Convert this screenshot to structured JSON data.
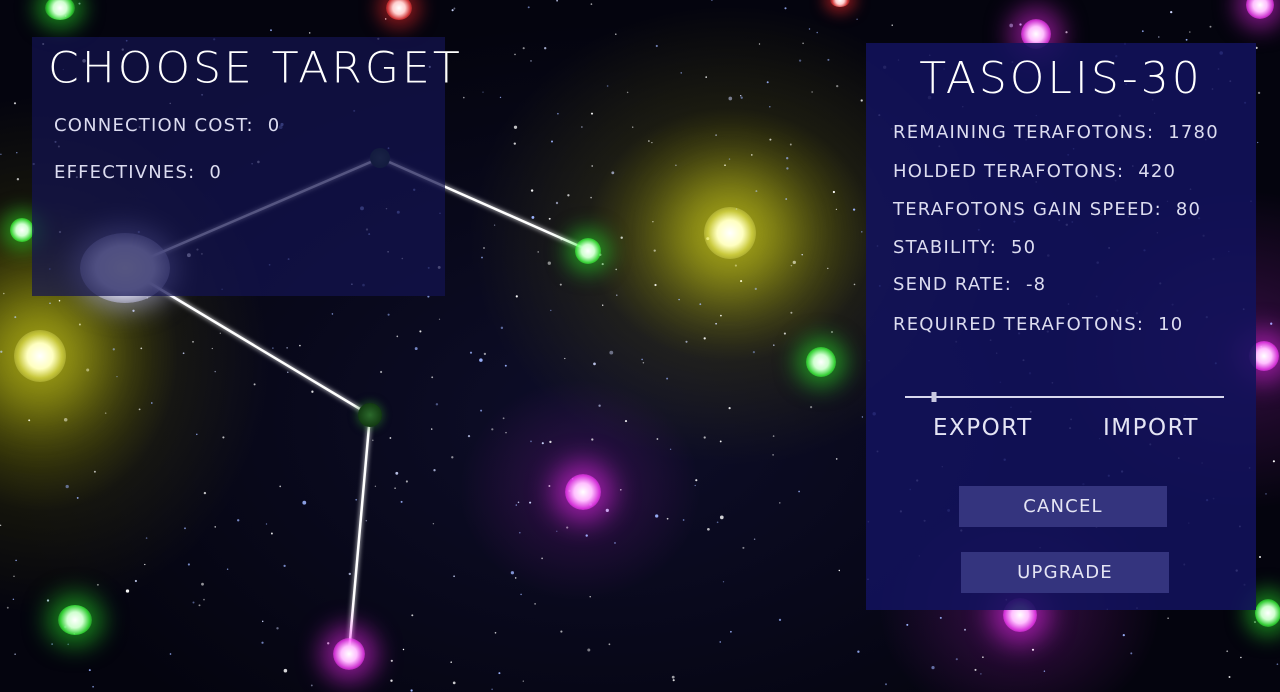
{
  "target_panel": {
    "title": "CHOOSE TARGET",
    "connection_cost_label": "CONNECTION COST:",
    "connection_cost_value": "0",
    "effectiveness_label": "EFFECTIVNES:",
    "effectiveness_value": "0"
  },
  "planet_panel": {
    "name": "TASOLIS-30",
    "stats": [
      {
        "label": "REMAINING TERAFOTONS:",
        "value": "1780"
      },
      {
        "label": "HOLDED TERAFOTONS:",
        "value": "420"
      },
      {
        "label": "TERAFOTONS GAIN SPEED:",
        "value": "80"
      },
      {
        "label": "STABILITY:",
        "value": "50"
      },
      {
        "label": "SEND RATE:",
        "value": "-8"
      },
      {
        "label": "REQUIRED TERAFOTONS:",
        "value": "10"
      }
    ],
    "send_rate_slider_fraction": 0.09,
    "export_label": "EXPORT",
    "import_label": "IMPORT",
    "cancel_label": "CANCEL",
    "upgrade_label": "UPGRADE"
  },
  "colors": {
    "panel": "#12125c",
    "button": "#34347e",
    "text": "#e8e8f4",
    "star_yellow": "#f0f060",
    "star_magenta": "#ff40ff",
    "star_green": "#40ff40",
    "star_red": "#ff4040"
  }
}
